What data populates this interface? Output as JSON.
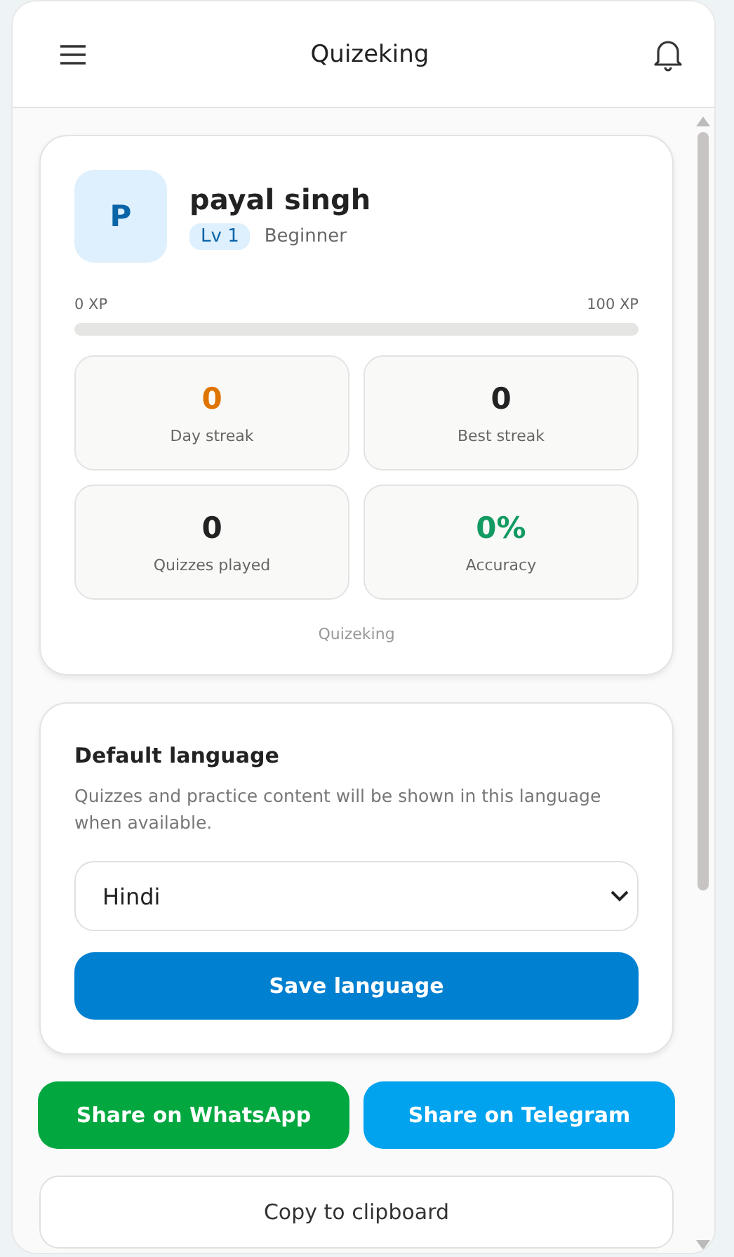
{
  "header": {
    "title": "Quizeking"
  },
  "profile": {
    "initial": "P",
    "name": "payal singh",
    "level_badge": "Lv 1",
    "rank": "Beginner",
    "xp_min": "0 XP",
    "xp_max": "100 XP",
    "level": 0
  },
  "stats": [
    {
      "value": "0",
      "label": "Day streak",
      "color": "#e07400"
    },
    {
      "value": "0",
      "label": "Best streak",
      "color": "#222222"
    },
    {
      "value": "0",
      "label": "Quizzes played",
      "color": "#222222"
    },
    {
      "value": "0%",
      "label": "Accuracy",
      "color": "#129a62"
    }
  ],
  "profile_footer": "Quizeking",
  "language": {
    "title": "Default language",
    "description": "Quizzes and practice content will be shown in this language when available.",
    "value": "Hindi",
    "save_button": "Save language"
  },
  "share_buttons": [
    {
      "label": "Share on WhatsApp",
      "color": "#02a83f"
    },
    {
      "label": "Share on Telegram",
      "color": "#02a3ee"
    }
  ],
  "copy_button": "Copy to clipboard"
}
